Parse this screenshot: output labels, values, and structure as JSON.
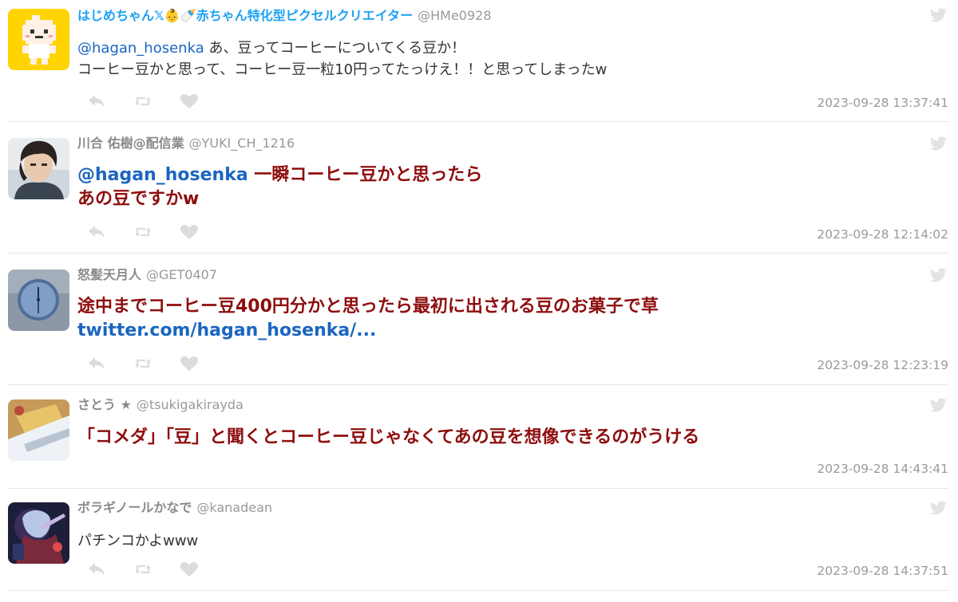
{
  "tweets": [
    {
      "name": "はじめちゃん𝕏👶🍼赤ちゃん特化型ピクセルクリエイター",
      "handle": "@HMe0928",
      "mention": "@hagan_hosenka",
      "line1": " あ、豆ってコーヒーについてくる豆か！",
      "line2": "コーヒー豆かと思って、コーヒー豆一粒10円ってたっけえ！！と思ってしまったw",
      "time": "2023-09-28 13:37:41",
      "avatar": "baby-pixel-avatar"
    },
    {
      "name": "川合 佑樹@配信業",
      "handle": "@YUKI_CH_1216",
      "mention": "@hagan_hosenka",
      "line1": " 一瞬コーヒー豆かと思ったら",
      "line2": "あの豆ですかw",
      "time": "2023-09-28 12:14:02",
      "avatar": "man-photo-avatar"
    },
    {
      "name": "怒髪天月人",
      "handle": "@GET0407",
      "line1": "途中までコーヒー豆400円分かと思ったら最初に出される豆のお菓子で草",
      "link": "twitter.com/hagan_hosenka/...",
      "time": "2023-09-28 12:23:19",
      "avatar": "clock-avatar"
    },
    {
      "name": "さとう ★",
      "handle": "@tsukigakirayda",
      "line1": "「コメダ」「豆」と聞くとコーヒー豆じゃなくてあの豆を想像できるのがうける",
      "time": "2023-09-28 14:43:41",
      "avatar": "photo-avatar"
    },
    {
      "name": "ボラギノールかなで",
      "handle": "@kanadean",
      "line1": "パチンコかよwww",
      "time": "2023-09-28 14:37:51",
      "avatar": "anime-avatar"
    }
  ],
  "icons": {
    "reply": "reply-icon",
    "retweet": "retweet-icon",
    "like": "heart-icon",
    "brand": "twitter-bird-icon"
  },
  "colors": {
    "name_highlight": "#1da1f2",
    "emphasis_text": "#8e0e0e",
    "mention": "#1a66c0"
  }
}
